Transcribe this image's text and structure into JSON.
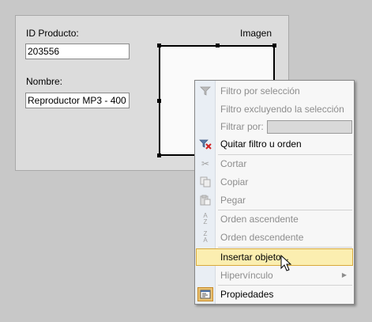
{
  "form": {
    "id_label": "ID Producto:",
    "id_value": "203556",
    "name_label": "Nombre:",
    "name_value": "Reproductor MP3 - 400",
    "image_label": "Imagen"
  },
  "context_menu": {
    "items": [
      {
        "label": "Filtro por selección",
        "enabled": false,
        "icon": "filter-selection-icon"
      },
      {
        "label": "Filtro excluyendo la selección",
        "enabled": false,
        "icon": "none"
      },
      {
        "label": "Filtrar por:",
        "enabled": false,
        "icon": "none",
        "input_value": ""
      },
      {
        "label": "Quitar filtro u orden",
        "enabled": true,
        "icon": "remove-filter-icon"
      },
      {
        "label": "Cortar",
        "enabled": false,
        "icon": "scissors-icon"
      },
      {
        "label": "Copiar",
        "enabled": false,
        "icon": "copy-icon"
      },
      {
        "label": "Pegar",
        "enabled": false,
        "icon": "paste-icon"
      },
      {
        "label": "Orden ascendente",
        "enabled": false,
        "icon": "sort-ascending-icon"
      },
      {
        "label": "Orden descendente",
        "enabled": false,
        "icon": "sort-descending-icon"
      },
      {
        "label": "Insertar objeto...",
        "enabled": true,
        "highlighted": true,
        "icon": "none"
      },
      {
        "label": "Hipervínculo",
        "enabled": false,
        "icon": "none",
        "submenu": true
      },
      {
        "label": "Propiedades",
        "enabled": true,
        "icon": "properties-icon"
      }
    ]
  },
  "colors": {
    "highlight_bg": "#fbeeb0",
    "highlight_border": "#d8a93b",
    "remove_filter_red": "#d22020"
  }
}
